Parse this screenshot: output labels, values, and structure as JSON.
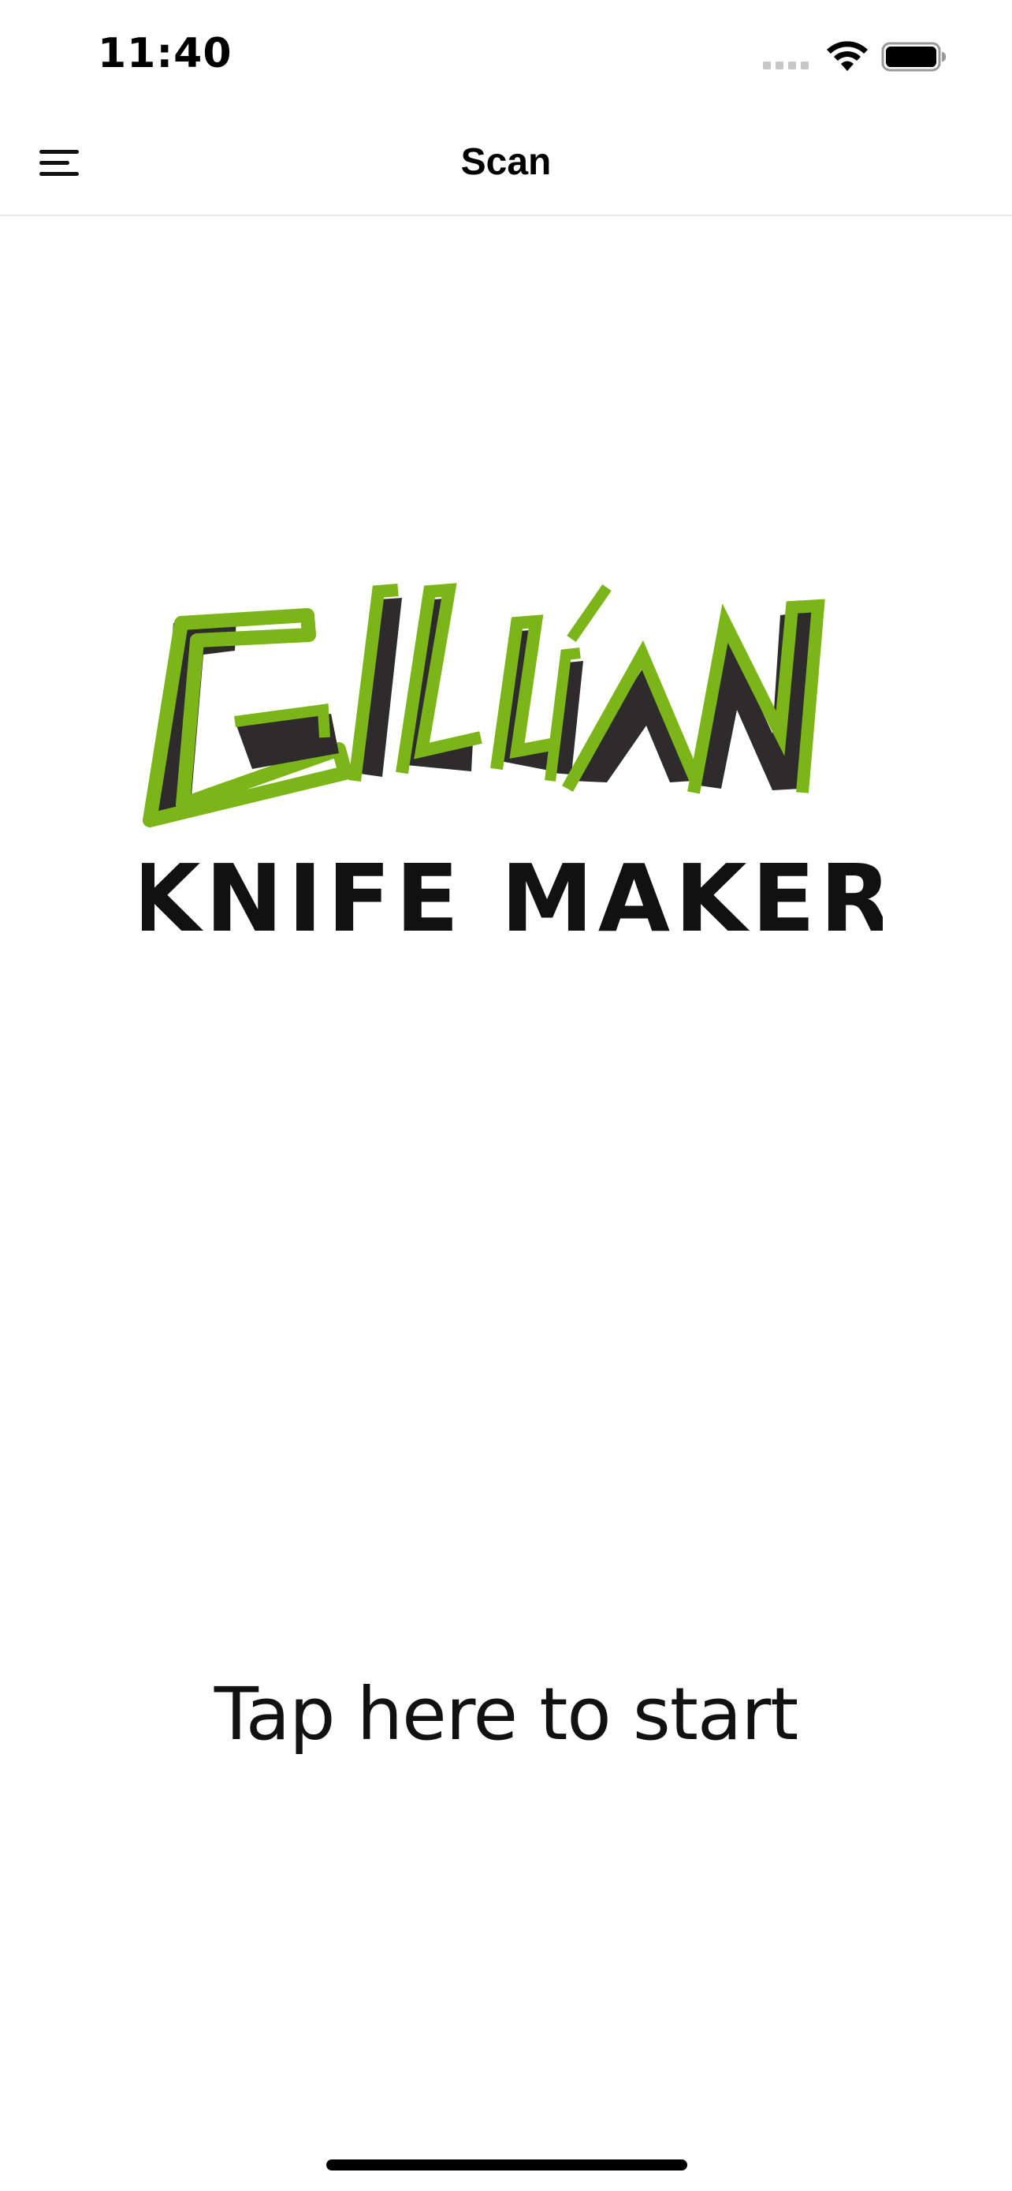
{
  "status_bar": {
    "time": "11:40"
  },
  "nav": {
    "title": "Scan",
    "menu_icon": "hamburger-menu-icon"
  },
  "logo": {
    "line1": "GILLIAN",
    "line2": "KNIFE MAKER",
    "colors": {
      "green": "#7cb518",
      "dark": "#2d2b2b",
      "text": "#111111"
    }
  },
  "main": {
    "start_label": "Tap here to start"
  }
}
